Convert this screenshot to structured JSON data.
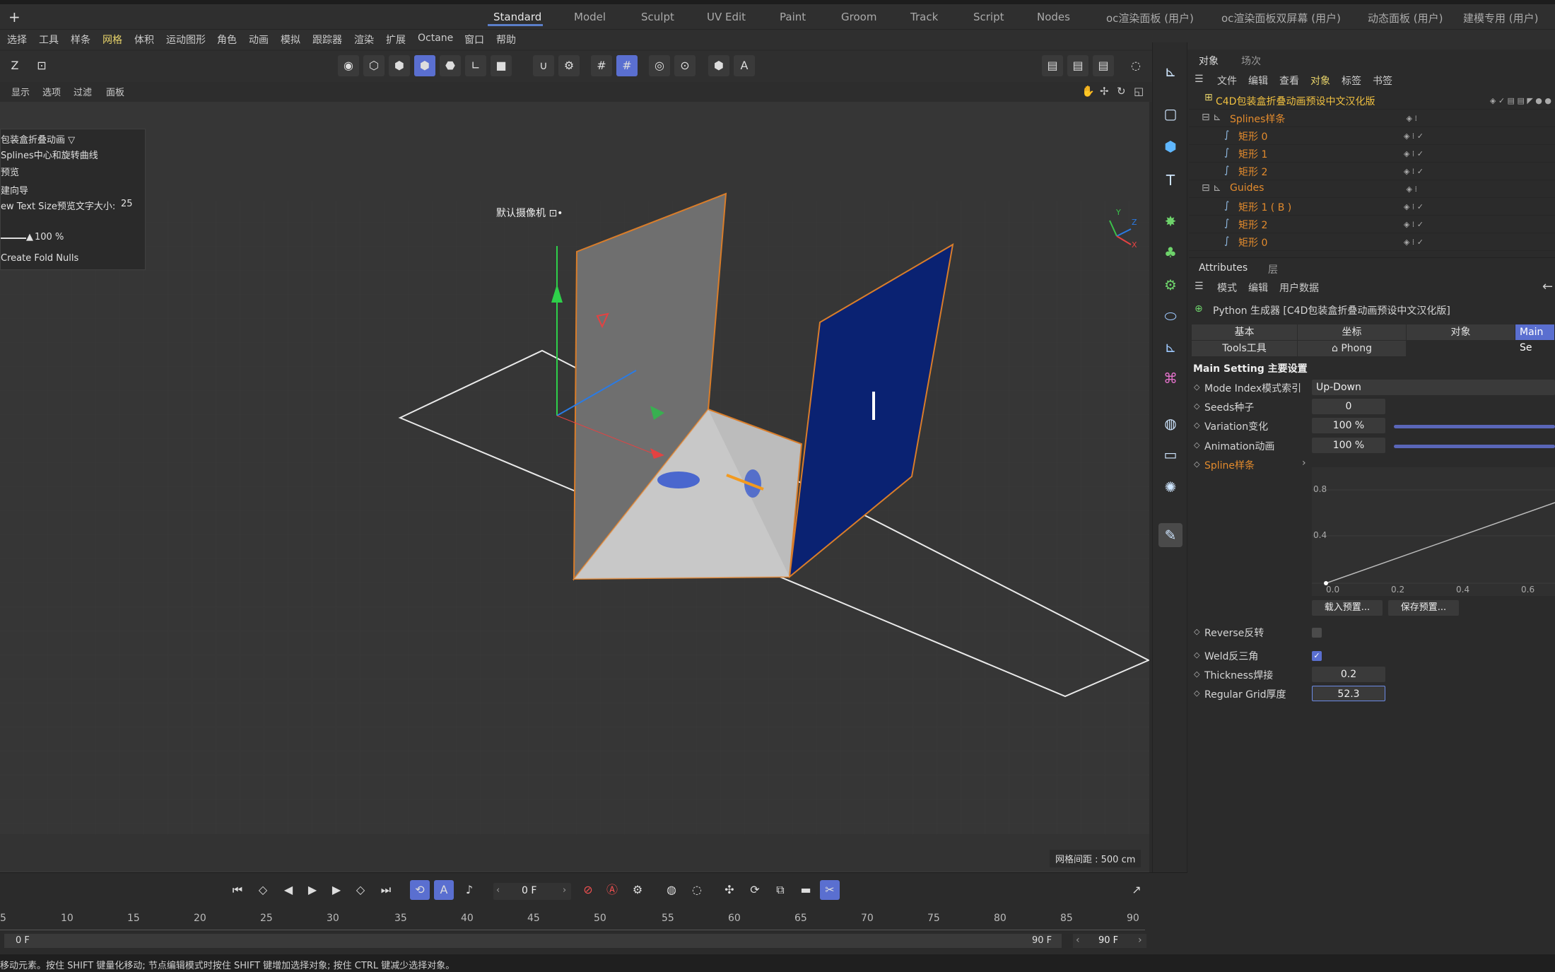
{
  "layouts": {
    "items": [
      "Standard",
      "Model",
      "Sculpt",
      "UV Edit",
      "Paint",
      "Groom",
      "Track",
      "Script",
      "Nodes",
      "oc渲染面板 (用户)",
      "oc渲染面板双屏幕 (用户)",
      "动态面板 (用户)",
      "建模专用 (用户)"
    ],
    "active": "Standard"
  },
  "menu": [
    "选择",
    "工具",
    "样条",
    "网格",
    "体积",
    "运动图形",
    "角色",
    "动画",
    "模拟",
    "跟踪器",
    "渲染",
    "扩展",
    "Octane",
    "窗口",
    "帮助"
  ],
  "menu_highlight": "网格",
  "viewport": {
    "menu": [
      "显示",
      "选项",
      "过滤",
      "面板"
    ],
    "camera": "默认摄像机 ⊡•",
    "grid_label": "网格间距 : 500 cm",
    "hud": {
      "title": "包装盒折叠动画 ▽",
      "line1": "Splines中心和旋转曲线",
      "line2": "预览",
      "line3": "建向导",
      "line4": "ew Text Size预览文字大小:",
      "line4_value": "25",
      "slider_value": "100 %",
      "line6": "Create Fold Nulls"
    },
    "axis": {
      "x": "X",
      "y": "Y",
      "z": "Z"
    }
  },
  "objects": {
    "tabs": [
      "对象",
      "场次"
    ],
    "menu": [
      "文件",
      "编辑",
      "查看",
      "对象",
      "标签",
      "书签"
    ],
    "rows": [
      {
        "name": "C4D包装盒折叠动画预设中文汉化版",
        "level": 0
      },
      {
        "name": "Splines样条",
        "level": 1
      },
      {
        "name": "矩形 0",
        "level": 2
      },
      {
        "name": "矩形 1",
        "level": 2
      },
      {
        "name": "矩形 2",
        "level": 2
      },
      {
        "name": "Guides",
        "level": 1
      },
      {
        "name": "矩形 1 ( B )",
        "level": 2
      },
      {
        "name": "矩形 2",
        "level": 2
      },
      {
        "name": "矩形 0",
        "level": 2
      }
    ]
  },
  "attributes": {
    "tabs": [
      "Attributes",
      "层"
    ],
    "menu": [
      "模式",
      "编辑",
      "用户数据"
    ],
    "object_title": "Python 生成器 [C4D包装盒折叠动画预设中文汉化版]",
    "subtabs": [
      "基本",
      "坐标",
      "对象",
      "Main Se"
    ],
    "subtabs2": [
      "Tools工具",
      "Phong"
    ],
    "section": "Main Setting 主要设置",
    "mode_label": "Mode Index模式索引",
    "mode_value": "Up-Down",
    "seeds_label": "Seeds种子",
    "seeds_value": "0",
    "variation_label": "Variation变化",
    "variation_value": "100 %",
    "animation_label": "Animation动画",
    "animation_value": "100 %",
    "spline_label": "Spline样条",
    "graph_y": [
      "0.8",
      "0.4"
    ],
    "graph_x": [
      "0.0",
      "0.2",
      "0.4",
      "0.6"
    ],
    "load_preset": "载入预置...",
    "save_preset": "保存预置...",
    "reverse_label": "Reverse反转",
    "weld_label": "Weld反三角",
    "thickness_label": "Thickness焊接",
    "thickness_value": "0.2",
    "grid_label": "Regular Grid厚度",
    "grid_value": "52.3"
  },
  "timeline": {
    "current_frame": "0 F",
    "ticks": [
      "5",
      "10",
      "15",
      "20",
      "25",
      "30",
      "35",
      "40",
      "45",
      "50",
      "55",
      "60",
      "65",
      "70",
      "75",
      "80",
      "85",
      "90"
    ],
    "start": "0 F",
    "end": "90 F",
    "end_field": "90 F"
  },
  "status": "移动元素。按住 SHIFT 键量化移动; 节点编辑模式时按住 SHIFT 键增加选择对象; 按住 CTRL 键减少选择对象。",
  "colors": {
    "accent": "#5a6fd0",
    "object_orange": "#e38b2d",
    "menu_highlight": "#e6d26a"
  }
}
